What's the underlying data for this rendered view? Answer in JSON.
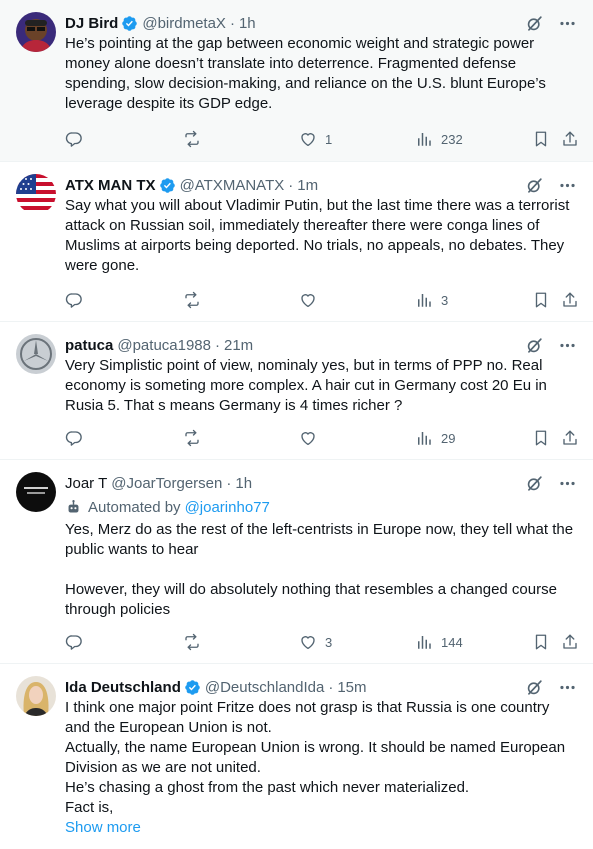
{
  "tweets": [
    {
      "name": "DJ Bird",
      "handle": "@birdmetaX",
      "time": "1h",
      "text": "He’s pointing at the gap between economic weight and strategic power money alone doesn’t translate into deterrence. Fragmented defense spending, slow decision-making, and reliance on the U.S. blunt Europe’s leverage despite its GDP edge.",
      "replies": "",
      "reposts": "",
      "likes": "1",
      "views": "232"
    },
    {
      "name": "ATX MAN TX",
      "handle": "@ATXMANATX",
      "time": "1m",
      "text": "Say what you will about Vladimir Putin, but the last time there was a terrorist attack on Russian soil, immediately thereafter there were conga lines of Muslims at airports being deported. No trials, no appeals, no debates. They were gone.",
      "replies": "",
      "reposts": "",
      "likes": "",
      "views": "3"
    },
    {
      "name": "patuca",
      "handle": "@patuca1988",
      "time": "21m",
      "text": "Very Simplistic point of view, nominaly yes, but in terms of PPP no. Real economy is someting more complex. A hair cut in Germany cost 20 Eu in Rusia 5. That s means Germany is 4 times richer ?",
      "replies": "",
      "reposts": "",
      "likes": "",
      "views": "29"
    },
    {
      "name": "Joar T",
      "handle": "@JoarTorgersen",
      "time": "1h",
      "automated_label": "Automated by",
      "automated_link": "@joarinho77",
      "text": "Yes, Merz do as the rest of the left-centrists in Europe now, they tell what the public wants to hear\n\nHowever, they will do absolutely nothing that resembles a changed course through policies",
      "replies": "",
      "reposts": "",
      "likes": "3",
      "views": "144"
    },
    {
      "name": "Ida Deutschland",
      "handle": "@DeutschlandIda",
      "time": "15m",
      "text": "I think one major point Fritze does not grasp is that Russia is one country and the European Union is not.\nActually, the name European Union is wrong. It should be named European Division as we are not united.\nHe’s chasing a ghost from the past which never materialized.\nFact is,",
      "show_more": "Show more"
    }
  ],
  "icons": {
    "more": "more-icon",
    "grok": "grok-icon",
    "reply": "reply-icon",
    "repost": "repost-icon",
    "like": "like-icon",
    "views": "views-icon",
    "bookmark": "bookmark-icon",
    "share": "share-icon",
    "verified": "verified-badge-icon",
    "robot": "robot-icon"
  },
  "colors": {
    "accent": "#1d9bf0",
    "secondary_text": "#536471",
    "highlight_bg": "#f7f9f9"
  }
}
